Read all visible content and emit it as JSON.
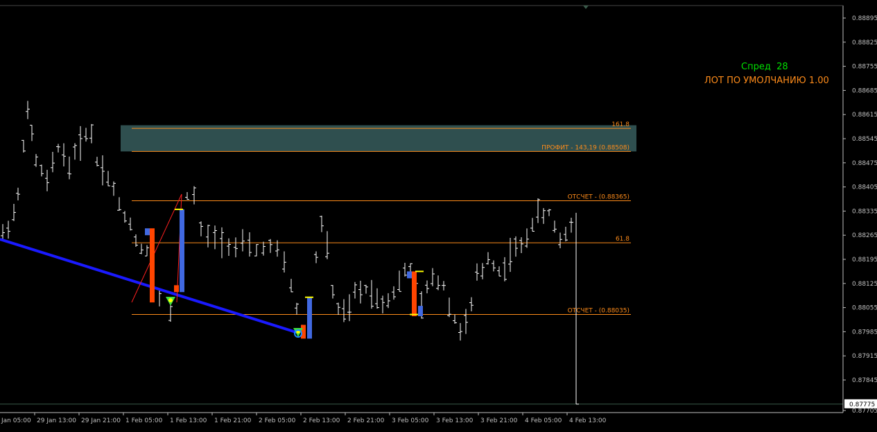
{
  "chart_data": {
    "type": "candlestick",
    "y_axis_ticks": [
      "0.88895",
      "0.88825",
      "0.88755",
      "0.88685",
      "0.88615",
      "0.88545",
      "0.88475",
      "0.88405",
      "0.88335",
      "0.88265",
      "0.88195",
      "0.88125",
      "0.88055",
      "0.87985",
      "0.87915",
      "0.87845",
      "0.87705"
    ],
    "x_axis_ticks": [
      "Jan 05:00",
      "29 Jan 13:00",
      "29 Jan 21:00",
      "1 Feb 05:00",
      "1 Feb 13:00",
      "1 Feb 21:00",
      "2 Feb 05:00",
      "2 Feb 13:00",
      "2 Feb 21:00",
      "3 Feb 05:00",
      "3 Feb 13:00",
      "3 Feb 21:00",
      "4 Feb 05:00",
      "4 Feb 13:00"
    ],
    "current_price": "0.87775",
    "ylim": [
      0.87705,
      0.88915
    ],
    "fib_levels": [
      {
        "label": "161.8",
        "price": 0.88575
      },
      {
        "label": "ПРОФИТ - 143,19 (0.88508)",
        "price": 0.88508
      },
      {
        "label": "ОТСЧЕТ - (0.88365)",
        "price": 0.88365
      },
      {
        "label": "61.8",
        "price": 0.88243
      },
      {
        "label": "ОТСЧЕТ - (0.88035)",
        "price": 0.88035
      }
    ],
    "profit_zone": {
      "from": 0.88508,
      "to": 0.88578
    },
    "colors": {
      "axis": "#c0c0c0",
      "fib": "#ff8c1a",
      "zone": "#2f4f4f",
      "trend": "#1a1aff",
      "bull": "#4169e1",
      "bear": "#ff4500",
      "bar": "#ffffff"
    }
  },
  "panel": {
    "spread_label": "Спред",
    "spread_value": "28",
    "lot_label": "ЛОТ ПО УМОЛЧАНИЮ 1.00"
  }
}
